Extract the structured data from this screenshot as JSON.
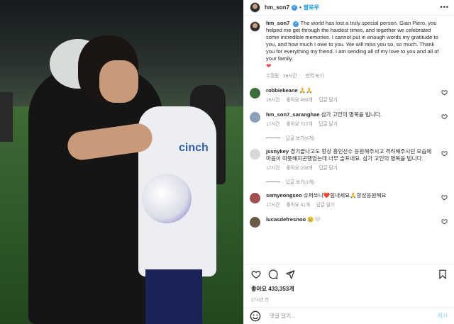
{
  "header": {
    "username": "hm_son7",
    "verified_mark": "✓",
    "dot": "•",
    "follow_label": "팔로우",
    "more_icon": "•••"
  },
  "caption": {
    "username": "hm_son7",
    "text": "The world has lost a truly special person. Gian Piero, you helped me get through the hardest times, and together we celebrated some incredible memories. I cannot put in enough words my gratitude to you, and how much I owe to you. We will miss you so, so much. Thank you for everything my friend. I am sending all of my love to you and all of your family.",
    "heart": "❤",
    "edited": "수정됨 · 36시간",
    "translate": "번역 보기"
  },
  "comments": [
    {
      "username": "robbiekeane",
      "text": "🙏🙏",
      "time": "15시간",
      "likes": "좋아요 459개",
      "reply": "답글 달기",
      "replies": "",
      "avatar_color": "#3c6e3c"
    },
    {
      "username": "hm_son7_saranghae",
      "text": "삼가 고인의 명복을 빕니다.",
      "time": "17시간",
      "likes": "좋아요 727개",
      "reply": "답글 달기",
      "replies": "답글 보기(6개)",
      "avatar_color": "#8aa0b8"
    },
    {
      "username": "jssnykey",
      "text": "경기끝나고도 항상 흥민선수 응원해주시고 격려해주시던 모습에 마음이 따뜻해지곤했었는데 너무 슬프네요. 삼가 고인의 명복을 빕니다.",
      "time": "17시간",
      "likes": "좋아요 208개",
      "reply": "답글 달기",
      "replies": "답글 보기(1개)",
      "avatar_color": "#d8d8d8"
    },
    {
      "username": "semyeongseo",
      "text": "슈퍼쏘니❤️힘내세요🙏항상응원해요",
      "time": "17시간",
      "likes": "좋아요 41개",
      "reply": "답글 달기",
      "replies": "",
      "avatar_color": "#a05050"
    },
    {
      "username": "lucasdefresnoo",
      "text": "😢🤍",
      "time": "",
      "likes": "",
      "reply": "",
      "replies": "",
      "avatar_color": "#6a5a48"
    }
  ],
  "actions": {
    "like_icon": "heart-outline-icon",
    "comment_icon": "comment-icon",
    "share_icon": "send-icon",
    "save_icon": "bookmark-icon"
  },
  "likes_text": "좋아요 433,353개",
  "post_time": "17시간 전",
  "add_comment": {
    "placeholder": "댓글 달기...",
    "post_label": "게시"
  },
  "photo": {
    "sponsor": "cinch"
  }
}
